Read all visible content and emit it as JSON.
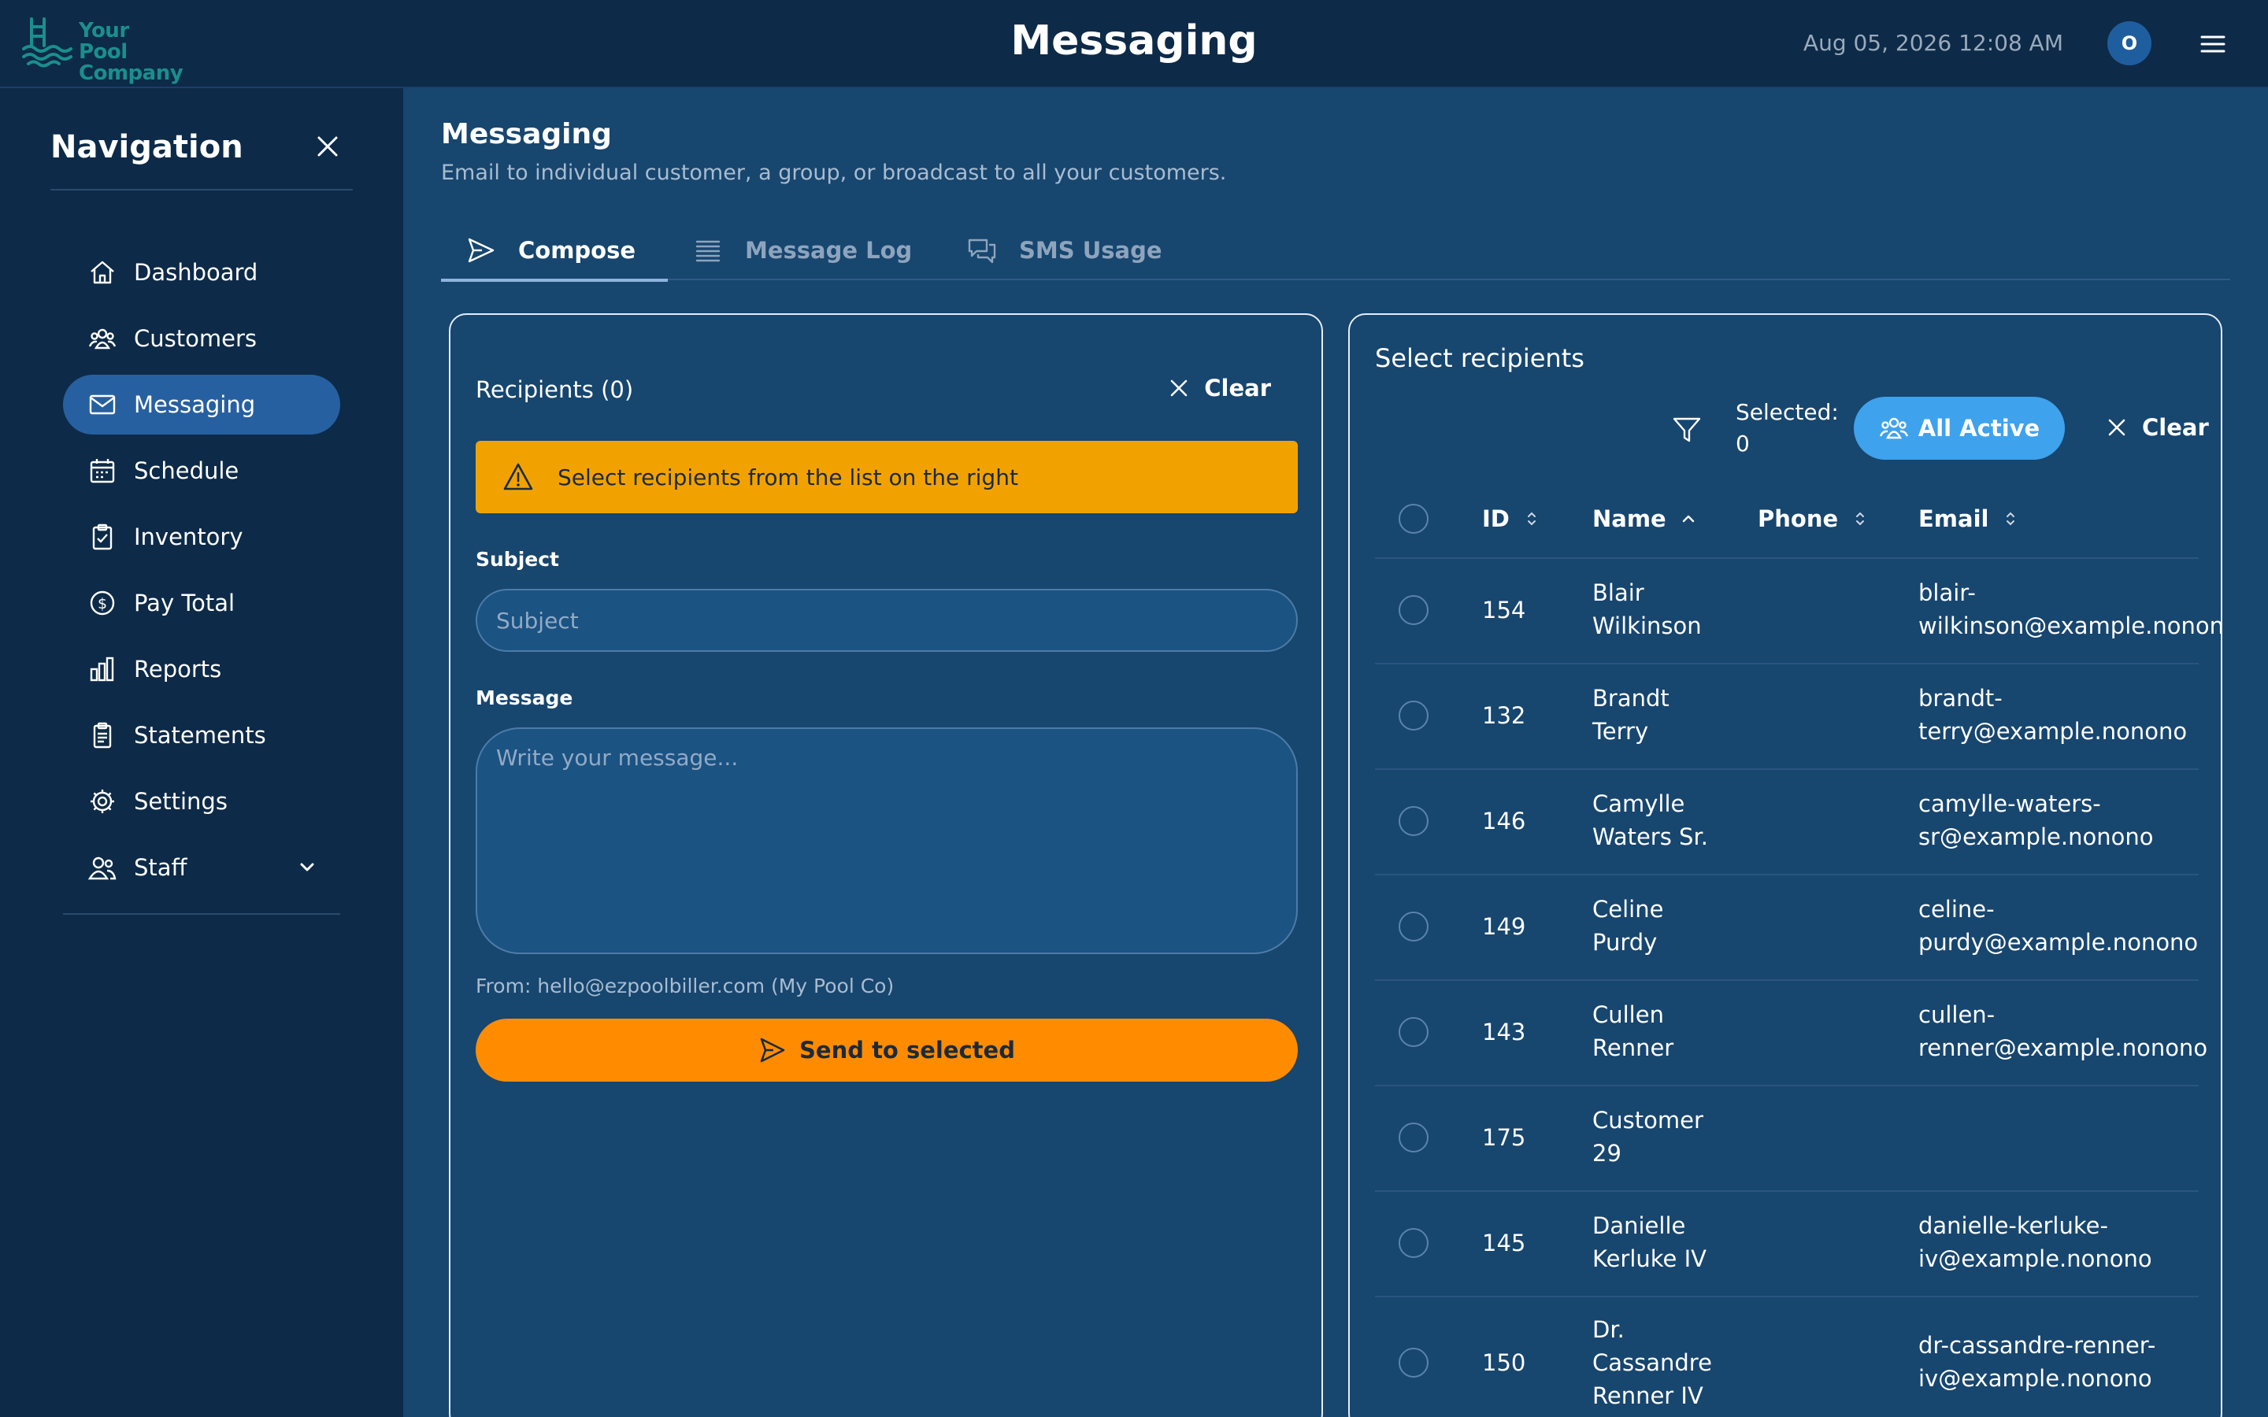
{
  "header": {
    "logo_line1": "Your Pool",
    "logo_line2": "Company",
    "title": "Messaging",
    "datetime": "Aug 05, 2026 12:08 AM",
    "avatar_initial": "O"
  },
  "sidebar": {
    "title": "Navigation",
    "items": [
      {
        "label": "Dashboard",
        "icon": "home-icon"
      },
      {
        "label": "Customers",
        "icon": "users-icon"
      },
      {
        "label": "Messaging",
        "icon": "envelope-icon",
        "active": true
      },
      {
        "label": "Schedule",
        "icon": "calendar-icon"
      },
      {
        "label": "Inventory",
        "icon": "clipboard-check-icon"
      },
      {
        "label": "Pay Total",
        "icon": "dollar-circle-icon"
      },
      {
        "label": "Reports",
        "icon": "bar-chart-icon"
      },
      {
        "label": "Statements",
        "icon": "documents-icon"
      },
      {
        "label": "Settings",
        "icon": "gear-icon"
      },
      {
        "label": "Staff",
        "icon": "staff-icon"
      }
    ]
  },
  "main": {
    "title": "Messaging",
    "subtitle": "Email to individual customer, a group, or broadcast to all your customers.",
    "tabs": [
      {
        "label": "Compose",
        "active": true
      },
      {
        "label": "Message Log"
      },
      {
        "label": "SMS Usage"
      }
    ]
  },
  "compose": {
    "recipients_label": "Recipients (0)",
    "clear_label": "Clear",
    "warning": "Select recipients from the list on the right",
    "subject_label": "Subject",
    "subject_placeholder": "Subject",
    "message_label": "Message",
    "message_placeholder": "Write your message...",
    "from_line": "From: hello@ezpoolbiller.com (My Pool Co)",
    "send_label": "Send to selected"
  },
  "recipients": {
    "title": "Select recipients",
    "selected_label": "Selected:",
    "selected_count": "0",
    "all_active_label": "All Active",
    "clear_label": "Clear",
    "columns": [
      "ID",
      "Name",
      "Phone",
      "Email"
    ],
    "rows": [
      {
        "id": "154",
        "name": [
          "Blair",
          "Wilkinson"
        ],
        "phone": "",
        "email": [
          "blair-",
          "wilkinson@example.nonono"
        ]
      },
      {
        "id": "132",
        "name": [
          "Brandt",
          "Terry"
        ],
        "phone": "",
        "email": [
          "brandt-",
          "terry@example.nonono"
        ]
      },
      {
        "id": "146",
        "name": [
          "Camylle",
          "Waters Sr."
        ],
        "phone": "",
        "email": [
          "camylle-waters-",
          "sr@example.nonono"
        ]
      },
      {
        "id": "149",
        "name": [
          "Celine",
          "Purdy"
        ],
        "phone": "",
        "email": [
          "celine-",
          "purdy@example.nonono"
        ]
      },
      {
        "id": "143",
        "name": [
          "Cullen",
          "Renner"
        ],
        "phone": "",
        "email": [
          "cullen-",
          "renner@example.nonono"
        ]
      },
      {
        "id": "175",
        "name": [
          "Customer",
          "29"
        ],
        "phone": "",
        "email": [
          "",
          ""
        ]
      },
      {
        "id": "145",
        "name": [
          "Danielle",
          "Kerluke IV"
        ],
        "phone": "",
        "email": [
          "danielle-kerluke-",
          "iv@example.nonono"
        ]
      },
      {
        "id": "150",
        "name": [
          "Dr.",
          "Cassandre",
          "Renner IV"
        ],
        "phone": "",
        "email": [
          "dr-cassandre-renner-",
          "iv@example.nonono"
        ]
      }
    ]
  },
  "colors": {
    "background": "#17466f",
    "topbar": "#0d2a48",
    "active_nav": "#2760a0",
    "warning": "#f2a200",
    "send_button": "#ff8c00",
    "all_active_button": "#3fa2ec"
  }
}
